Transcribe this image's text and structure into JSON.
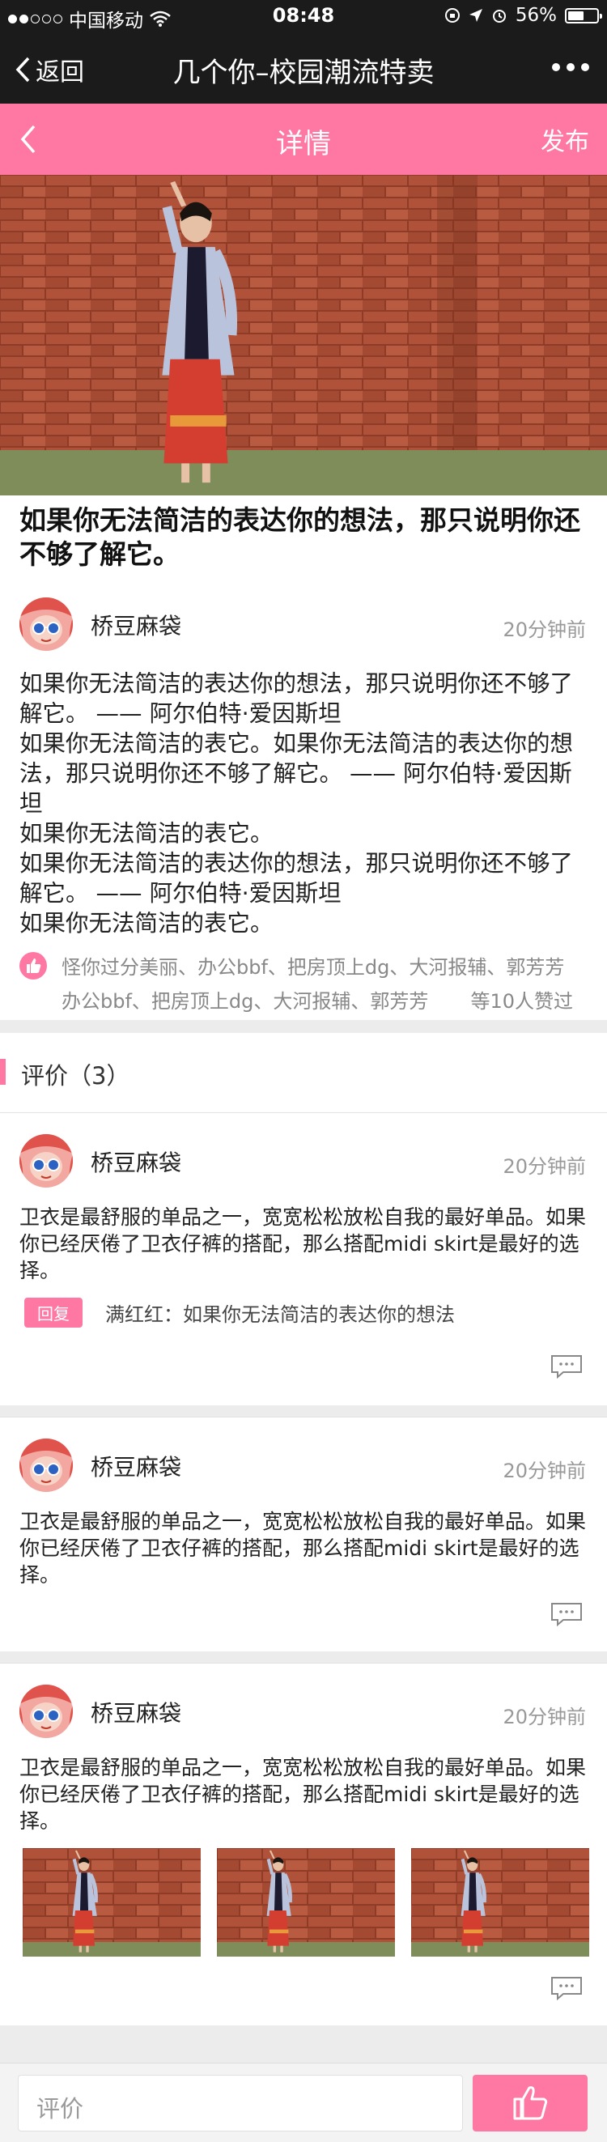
{
  "status_bar": {
    "carrier": "中国移动",
    "time": "08:48",
    "battery": "56%",
    "battery_level": 0.56
  },
  "wechat_nav": {
    "back_label": "返回",
    "title": "几个你–校园潮流特卖"
  },
  "header": {
    "title": "详情",
    "publish_label": "发布"
  },
  "post": {
    "title": "如果你无法简洁的表达你的想法，那只说明你还不够了解它。",
    "author": "桥豆麻袋",
    "time": "20分钟前",
    "body": "如果你无法简洁的表达你的想法，那只说明你还不够了解它。 —— 阿尔伯特·爱因斯坦\n如果你无法简洁的表它。如果你无法简洁的表达你的想法，那只说明你还不够了解它。 —— 阿尔伯特·爱因斯坦\n如果你无法简洁的表它。\n如果你无法简洁的表达你的想法，那只说明你还不够了解它。 —— 阿尔伯特·爱因斯坦\n如果你无法简洁的表它。",
    "likes_line1": "怪你过分美丽、办公bbf、把房顶上dg、大河报辅、郭芳芳",
    "likes_line2": "办公bbf、把房顶上dg、大河报辅、郭芳芳",
    "likes_count": "等10人赞过"
  },
  "comments_section": {
    "label": "评价（3）"
  },
  "comments": [
    {
      "author": "桥豆麻袋",
      "time": "20分钟前",
      "text": "卫衣是最舒服的单品之一，宽宽松松放松自我的最好单品。如果你已经厌倦了卫衣仔裤的搭配，那么搭配midi skirt是最好的选择。",
      "reply_tag": "回复",
      "reply_text": "满红红：如果你无法简洁的表达你的想法"
    },
    {
      "author": "桥豆麻袋",
      "time": "20分钟前",
      "text": "卫衣是最舒服的单品之一，宽宽松松放松自我的最好单品。如果你已经厌倦了卫衣仔裤的搭配，那么搭配midi skirt是最好的选择。"
    },
    {
      "author": "桥豆麻袋",
      "time": "20分钟前",
      "text": "卫衣是最舒服的单品之一，宽宽松松放松自我的最好单品。如果你已经厌倦了卫衣仔裤的搭配，那么搭配midi skirt是最好的选择。"
    }
  ],
  "bottom_bar": {
    "input_placeholder": "评价"
  },
  "colors": {
    "accent": "#fe78a3",
    "dark_bar": "#1b1b1b",
    "brick": "#a5472f"
  },
  "icons": [
    "signal-dots-icon",
    "wifi-icon",
    "location-icon",
    "alarm-icon",
    "battery-icon",
    "back-icon",
    "more-icon",
    "chevron-left-icon",
    "thumbs-up-icon",
    "message-icon"
  ]
}
